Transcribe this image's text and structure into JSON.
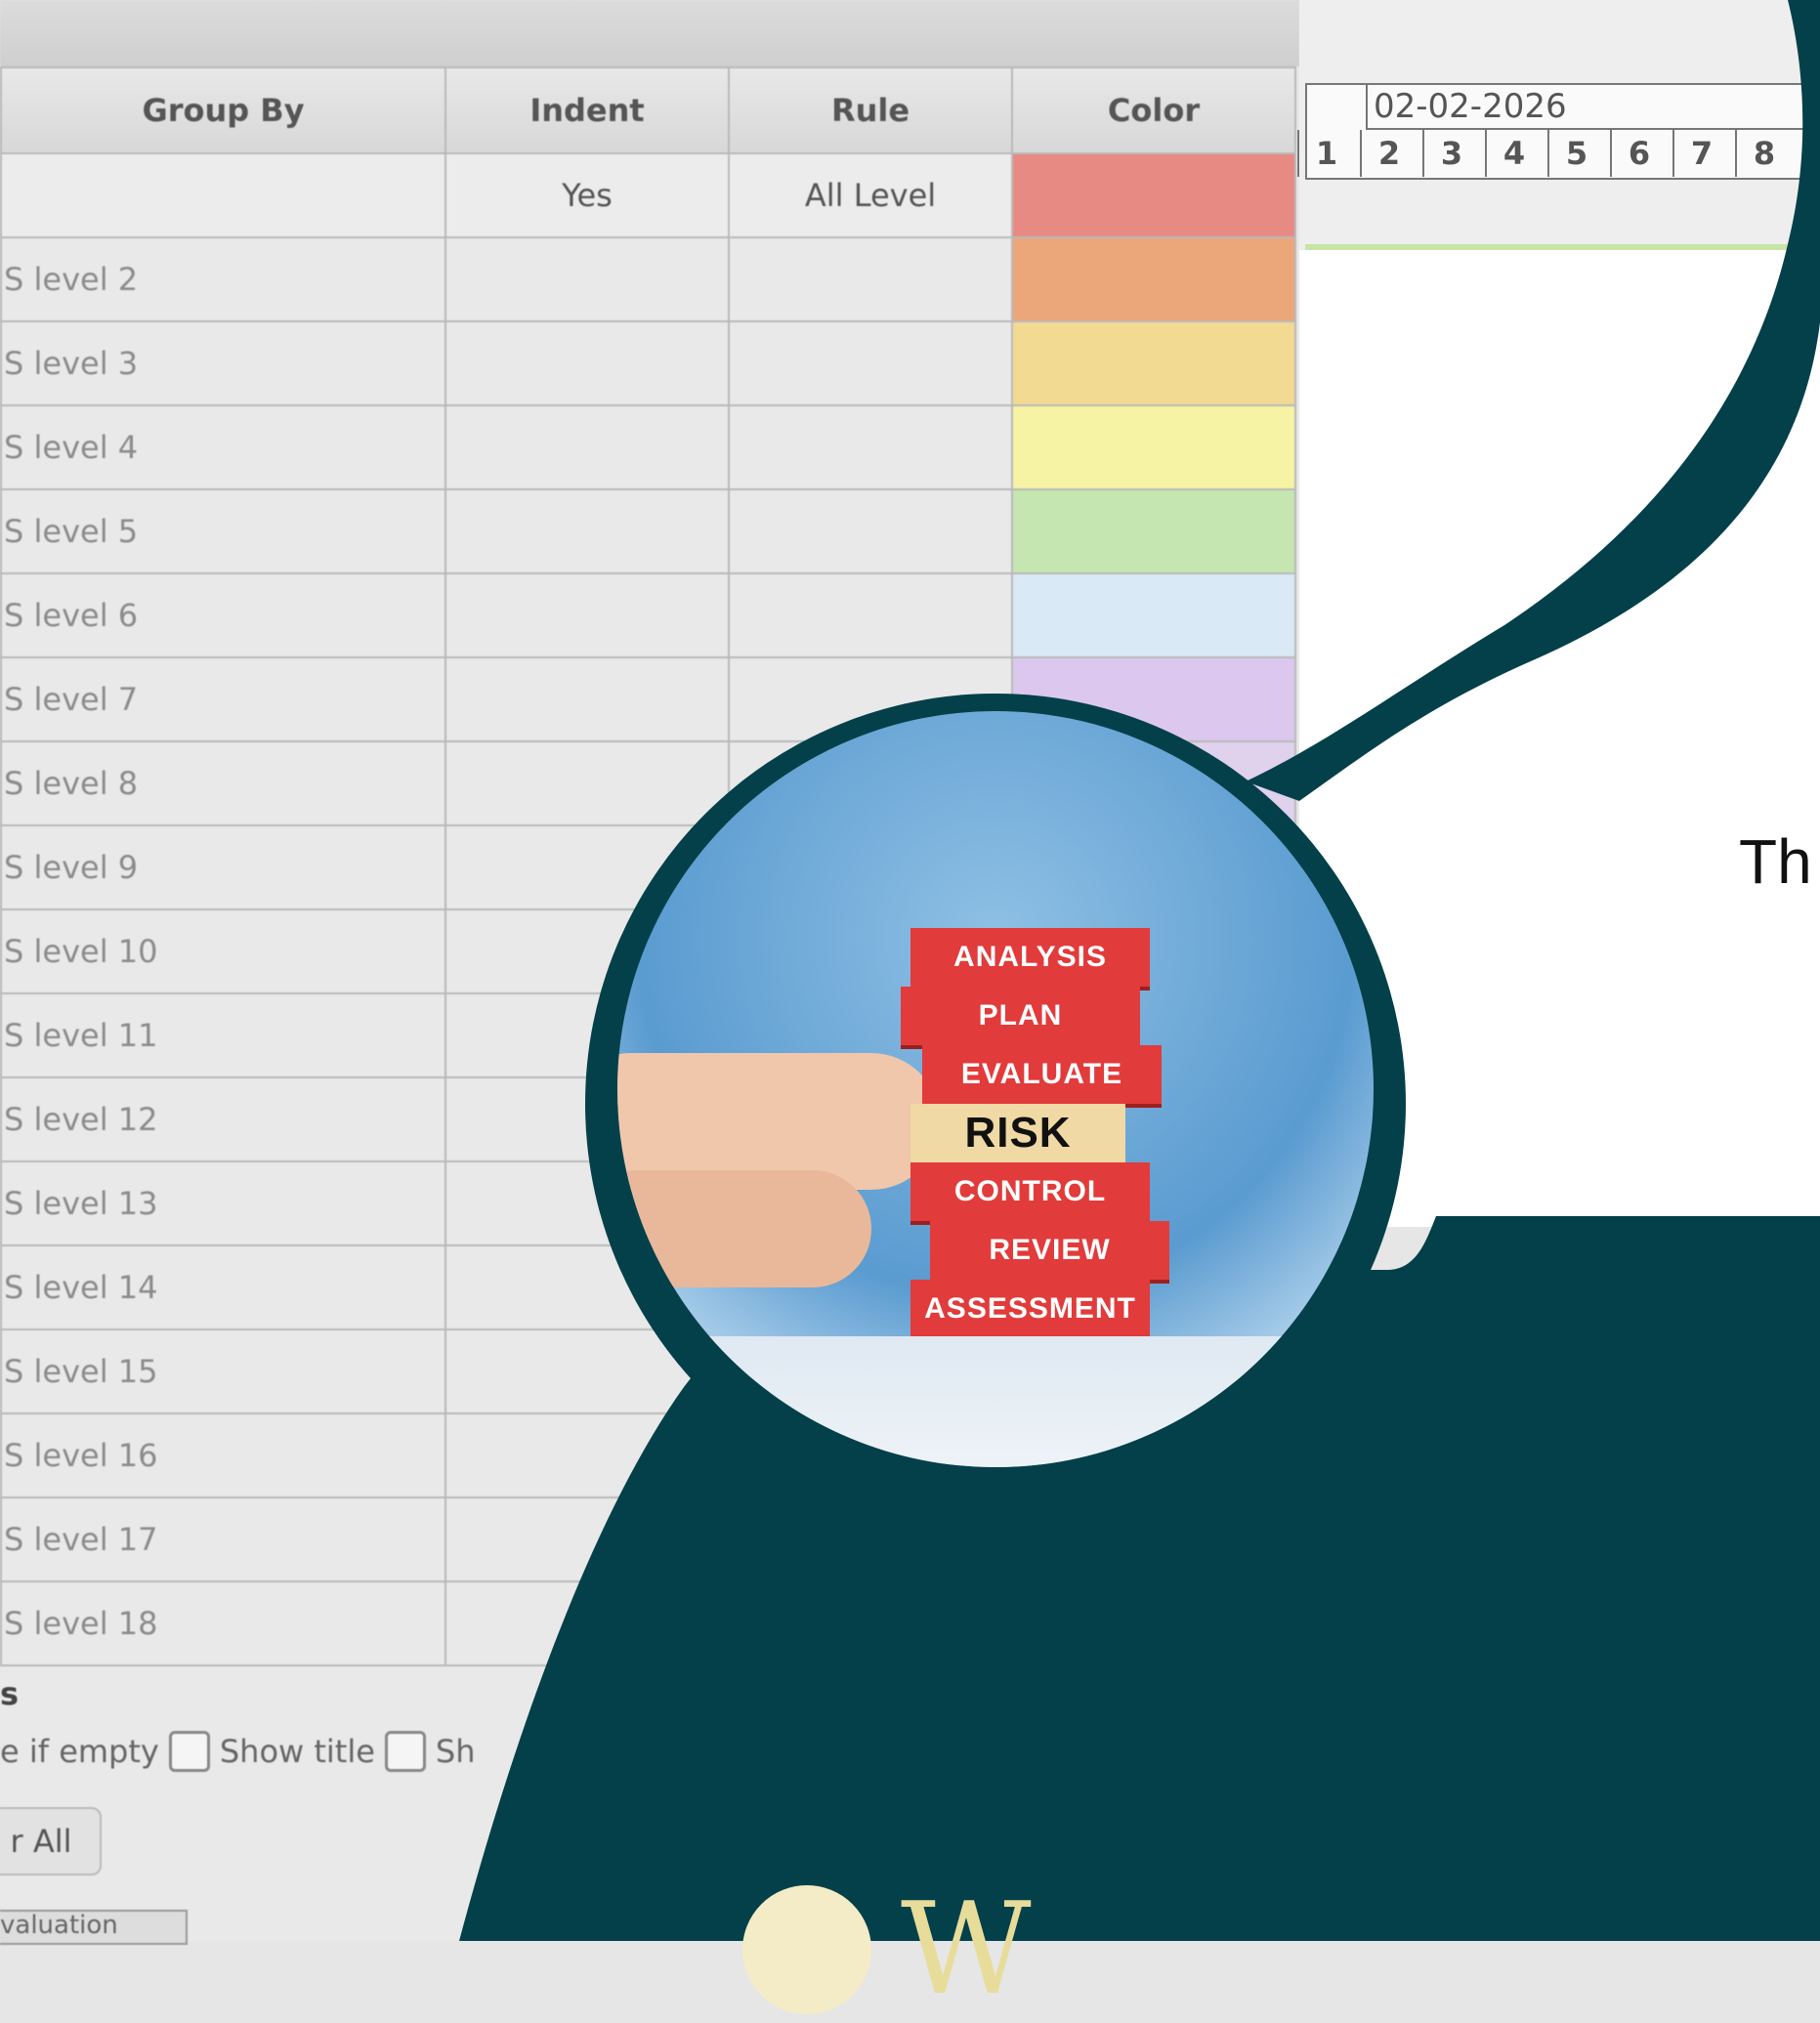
{
  "table": {
    "headers": [
      "Group By",
      "Indent",
      "Rule",
      "Color"
    ],
    "rows": [
      {
        "group": "",
        "indent": "Yes",
        "rule": "All Level",
        "color": "#e88a84"
      },
      {
        "group": "S level 2",
        "indent": "",
        "rule": "",
        "color": "#eba67a"
      },
      {
        "group": "S level 3",
        "indent": "",
        "rule": "",
        "color": "#f3da93"
      },
      {
        "group": "S level 4",
        "indent": "",
        "rule": "",
        "color": "#f7f3a4"
      },
      {
        "group": "S level 5",
        "indent": "",
        "rule": "",
        "color": "#c5e6b0"
      },
      {
        "group": "S level 6",
        "indent": "",
        "rule": "",
        "color": "#d9e9f5"
      },
      {
        "group": "S level 7",
        "indent": "",
        "rule": "",
        "color": "#dcc8ee"
      },
      {
        "group": "S level 8",
        "indent": "",
        "rule": "",
        "color": "#e0d1ec"
      },
      {
        "group": "S level 9",
        "indent": "",
        "rule": "",
        "color": ""
      },
      {
        "group": "S level 10",
        "indent": "",
        "rule": "",
        "color": ""
      },
      {
        "group": "S level 11",
        "indent": "",
        "rule": "",
        "color": ""
      },
      {
        "group": "S level 12",
        "indent": "",
        "rule": "",
        "color": ""
      },
      {
        "group": "S level 13",
        "indent": "",
        "rule": "",
        "color": ""
      },
      {
        "group": "S level 14",
        "indent": "",
        "rule": "",
        "color": ""
      },
      {
        "group": "S level 15",
        "indent": "",
        "rule": "",
        "color": ""
      },
      {
        "group": "S level 16",
        "indent": "",
        "rule": "",
        "color": ""
      },
      {
        "group": "S level 17",
        "indent": "",
        "rule": "",
        "color": ""
      },
      {
        "group": "S level 18",
        "indent": "",
        "rule": "",
        "color": ""
      }
    ]
  },
  "options": {
    "heading": "s",
    "hide_if_empty": "e if empty",
    "show_title": "Show title",
    "show_other": "Sh"
  },
  "clear_all_label": "r All",
  "bottom_tab_label": "valuation",
  "timeline": {
    "date": "02-02-2026",
    "days": [
      "1",
      "2",
      "3",
      "4",
      "5",
      "6",
      "7",
      "8"
    ]
  },
  "photo_blocks": [
    "ANALYSIS",
    "PLAN",
    "EVALUATE",
    "RISK",
    "CONTROL",
    "REVIEW",
    "ASSESSMENT"
  ],
  "tagline": "Th",
  "brand": "W",
  "colors": {
    "teal": "#03404a",
    "brand_gold": "#e8dc9a",
    "block_red": "#e23b3b"
  }
}
